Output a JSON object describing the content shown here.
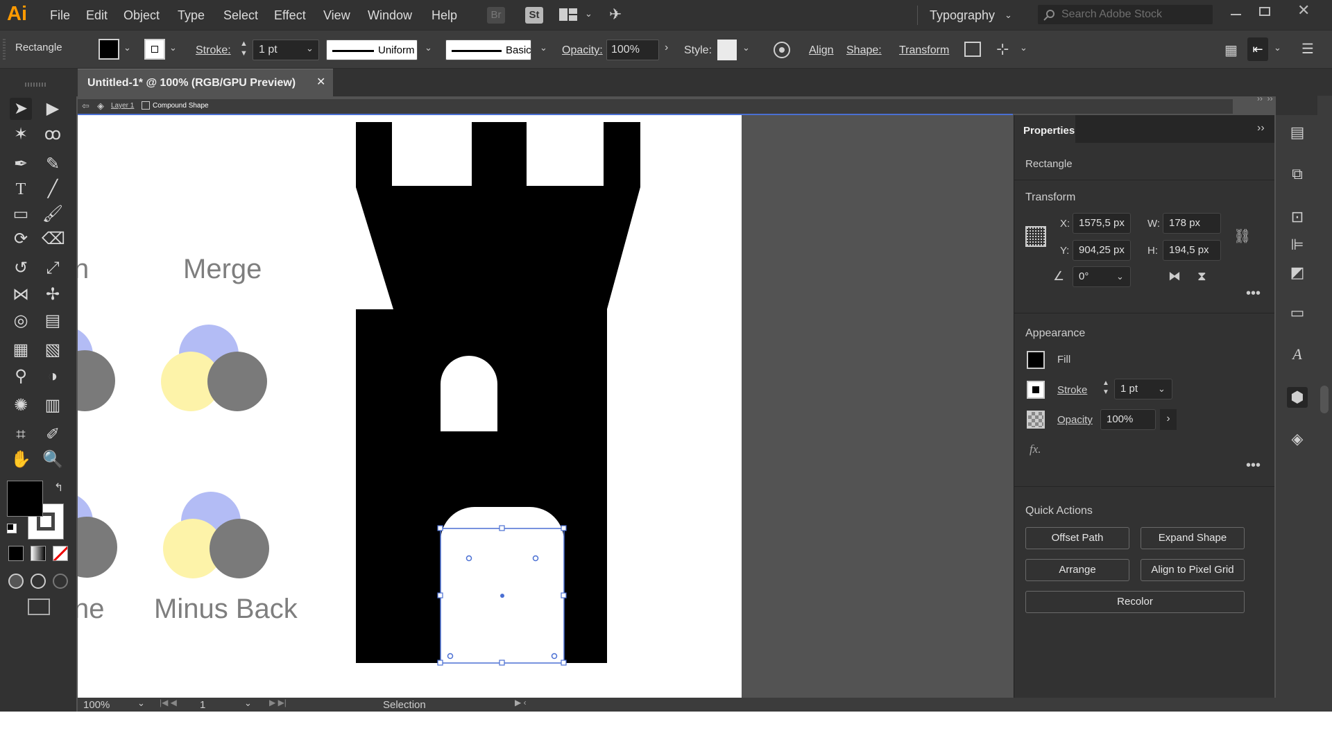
{
  "app": {
    "logo": "Ai",
    "menu": [
      "File",
      "Edit",
      "Object",
      "Type",
      "Select",
      "Effect",
      "View",
      "Window",
      "Help"
    ],
    "bridge_label": "Br",
    "stock_label": "St",
    "workspace": "Typography",
    "search_placeholder": "Search Adobe Stock"
  },
  "control": {
    "selection_type": "Rectangle",
    "stroke_label": "Stroke:",
    "stroke_value": "1 pt",
    "profile": "Uniform",
    "brush": "Basic",
    "opacity_label": "Opacity:",
    "opacity_value": "100%",
    "style_label": "Style:",
    "align": "Align",
    "shape": "Shape:",
    "transform": "Transform"
  },
  "document": {
    "tab_title": "Untitled-1* @ 100% (RGB/GPU Preview)",
    "breadcrumb_layer": "Layer 1",
    "breadcrumb_object": "Compound Shape"
  },
  "canvas": {
    "labels": {
      "partial_top": "n",
      "merge": "Merge",
      "partial_bottom": "ne",
      "minus_back": "Minus Back"
    },
    "colors": {
      "circle_blue": "#b3bcf5",
      "circle_yellow": "#fdf3a9",
      "circle_gray": "#7a7a7a",
      "selection": "#4a6fd3"
    }
  },
  "properties": {
    "tab": "Properties",
    "object_type": "Rectangle",
    "transform_title": "Transform",
    "x_label": "X:",
    "x": "1575,5 px",
    "y_label": "Y:",
    "y": "904,25 px",
    "w_label": "W:",
    "w": "178 px",
    "h_label": "H:",
    "h": "194,5 px",
    "angle": "0°",
    "appearance_title": "Appearance",
    "fill_label": "Fill",
    "stroke_label": "Stroke",
    "stroke_value": "1 pt",
    "opacity_label": "Opacity",
    "opacity_value": "100%",
    "fx_label": "fx.",
    "quick_actions_title": "Quick Actions",
    "quick_actions": [
      "Offset Path",
      "Expand Shape",
      "Arrange",
      "Align to Pixel Grid",
      "Recolor"
    ]
  },
  "status": {
    "zoom": "100%",
    "page": "1",
    "tool": "Selection"
  }
}
